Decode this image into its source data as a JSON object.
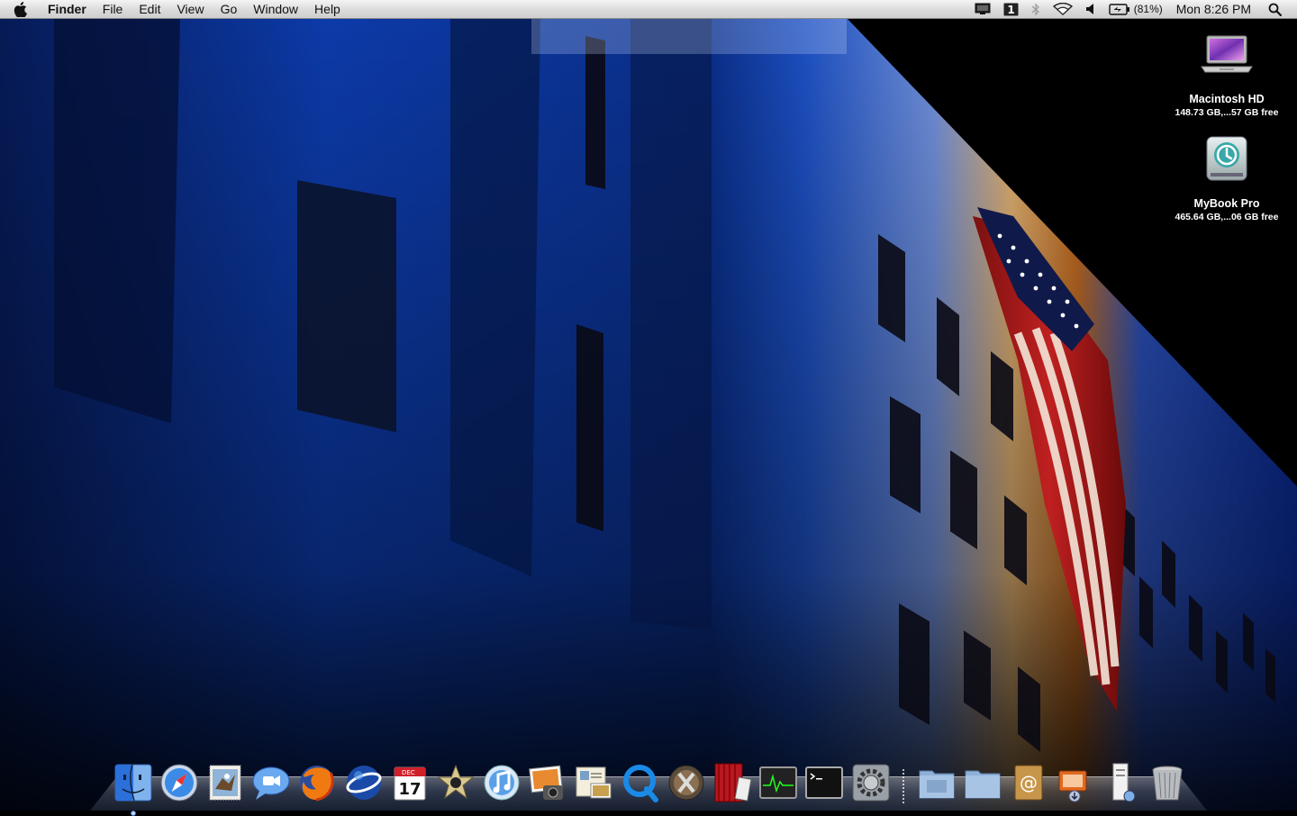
{
  "menubar": {
    "apple_icon": "apple-icon",
    "app_name": "Finder",
    "menus": [
      "File",
      "Edit",
      "View",
      "Go",
      "Window",
      "Help"
    ],
    "status": {
      "battery_percent": "(81%)",
      "clock": "Mon 8:26 PM",
      "icons": [
        "display-mirror-icon",
        "input-menu-icon",
        "bluetooth-icon",
        "wifi-icon",
        "volume-icon",
        "battery-icon",
        "spotlight-search-icon"
      ]
    }
  },
  "desktop": {
    "icons": [
      {
        "name": "Macintosh HD",
        "info": "148.73 GB,...57 GB free",
        "icon": "laptop-drive-icon"
      },
      {
        "name": "MyBook Pro",
        "info": "465.64 GB,...06 GB free",
        "icon": "time-machine-drive-icon"
      }
    ]
  },
  "dock": {
    "items": [
      {
        "name": "finder-icon",
        "running": true
      },
      {
        "name": "safari-icon",
        "running": false
      },
      {
        "name": "mail-icon",
        "running": false
      },
      {
        "name": "ichat-icon",
        "running": false
      },
      {
        "name": "firefox-icon",
        "running": false
      },
      {
        "name": "google-earth-icon",
        "running": false
      },
      {
        "name": "ical-icon",
        "running": false,
        "month": "DEC",
        "day": "17"
      },
      {
        "name": "imovie-icon",
        "running": false
      },
      {
        "name": "itunes-icon",
        "running": false
      },
      {
        "name": "iphoto-icon",
        "running": false
      },
      {
        "name": "preview-icon",
        "running": false
      },
      {
        "name": "quicktime-icon",
        "running": false
      },
      {
        "name": "x11-icon",
        "running": false
      },
      {
        "name": "photo-booth-icon",
        "running": false
      },
      {
        "name": "activity-monitor-icon",
        "running": false
      },
      {
        "name": "terminal-icon",
        "running": false
      },
      {
        "name": "system-preferences-icon",
        "running": false
      },
      {
        "name": "applications-folder-icon",
        "running": false
      },
      {
        "name": "documents-folder-icon",
        "running": false
      },
      {
        "name": "address-book-icon",
        "running": false
      },
      {
        "name": "downloads-stack-icon",
        "running": false
      },
      {
        "name": "printer-icon",
        "running": false
      },
      {
        "name": "trash-icon",
        "running": false
      }
    ]
  }
}
